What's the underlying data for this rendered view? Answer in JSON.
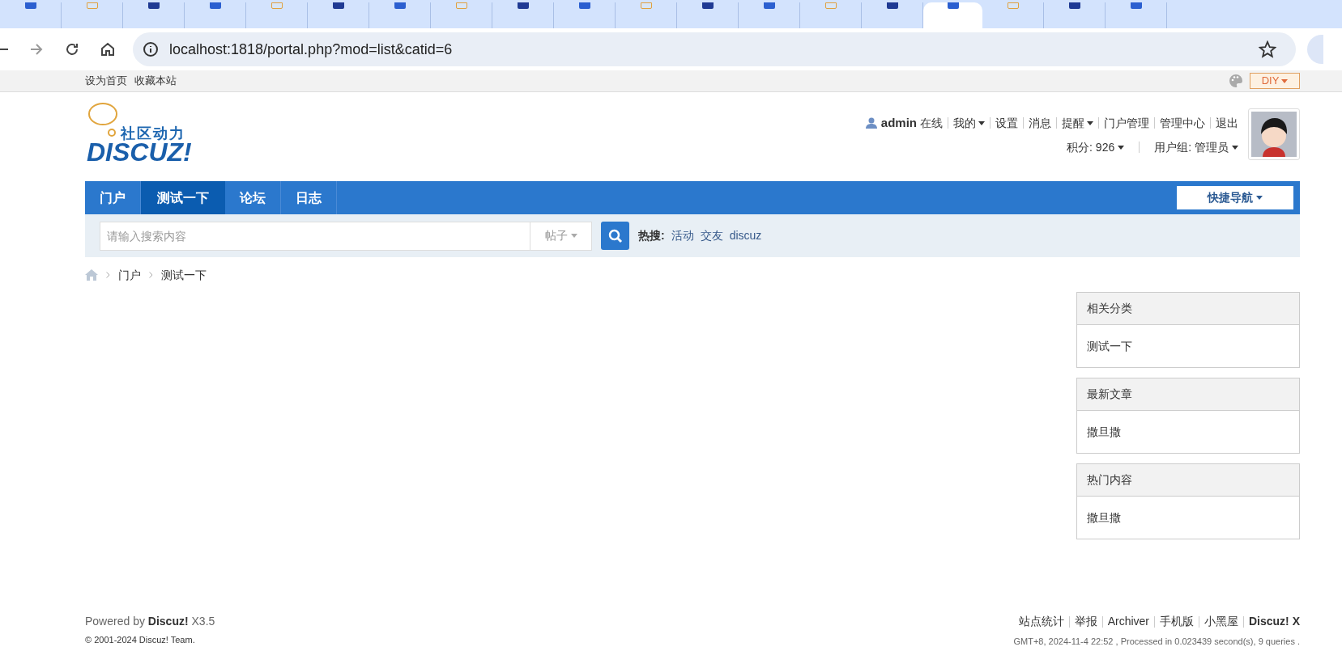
{
  "browser": {
    "tabs": [
      {
        "selected": false
      },
      {
        "selected": false
      },
      {
        "selected": false
      },
      {
        "selected": false
      },
      {
        "selected": false
      },
      {
        "selected": false
      },
      {
        "selected": false
      },
      {
        "selected": false
      },
      {
        "selected": false
      },
      {
        "selected": false
      },
      {
        "selected": false
      },
      {
        "selected": false
      },
      {
        "selected": false
      },
      {
        "selected": false
      },
      {
        "selected": false
      },
      {
        "selected": true
      },
      {
        "selected": false
      },
      {
        "selected": false
      },
      {
        "selected": false
      }
    ],
    "address": "localhost:1818/portal.php?mod=list&catid=6"
  },
  "topbar": {
    "links": [
      "设为首页",
      "收藏本站"
    ],
    "diy": "DIY"
  },
  "user": {
    "name": "admin",
    "status": "在线",
    "links": [
      {
        "label": "我的",
        "dropdown": true
      },
      {
        "label": "设置",
        "dropdown": false
      },
      {
        "label": "消息",
        "dropdown": false
      },
      {
        "label": "提醒",
        "dropdown": true
      },
      {
        "label": "门户管理",
        "dropdown": false
      },
      {
        "label": "管理中心",
        "dropdown": false
      },
      {
        "label": "退出",
        "dropdown": false
      }
    ],
    "credits": "积分: 926",
    "group": "用户组: 管理员"
  },
  "logo": {
    "tagline": "社区动力",
    "wordmark": "DISCUZ!"
  },
  "nav": {
    "items": [
      {
        "label": "门户",
        "selected": false
      },
      {
        "label": "测试一下",
        "selected": true
      },
      {
        "label": "论坛",
        "selected": false
      },
      {
        "label": "日志",
        "selected": false
      }
    ],
    "quick": "快捷导航"
  },
  "search": {
    "placeholder": "请输入搜索内容",
    "scope": "帖子",
    "hot_label": "热搜:",
    "hot": [
      "活动",
      "交友",
      "discuz"
    ]
  },
  "breadcrumb": [
    "门户",
    "测试一下"
  ],
  "sidebar": [
    {
      "title": "相关分类",
      "items": [
        "测试一下"
      ]
    },
    {
      "title": "最新文章",
      "items": [
        "撒旦撒"
      ]
    },
    {
      "title": "热门内容",
      "items": [
        "撒旦撒"
      ]
    }
  ],
  "footer": {
    "powered_prefix": "Powered by",
    "powered_brand": "Discuz!",
    "powered_version": "X3.5",
    "copyright": "© 2001-2024 Discuz! Team.",
    "links": [
      "站点统计",
      "举报",
      "Archiver",
      "手机版",
      "小黑屋"
    ],
    "brand": "Discuz! X",
    "stats": "GMT+8, 2024-11-4 22:52 , Processed in 0.023439 second(s), 9 queries ."
  }
}
